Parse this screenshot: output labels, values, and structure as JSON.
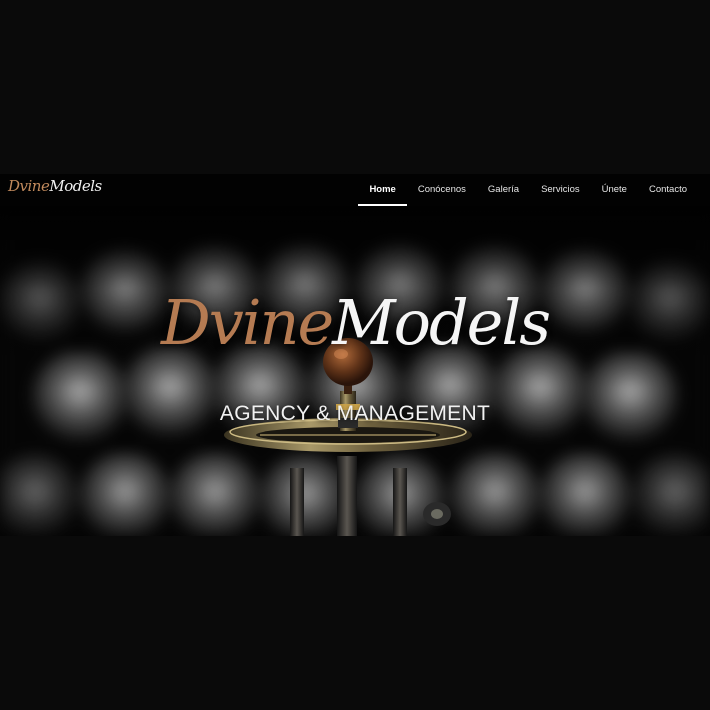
{
  "nav": {
    "logo": {
      "part1": "Dvine",
      "part2": "Models"
    },
    "items": [
      {
        "label": "Home",
        "active": true
      },
      {
        "label": "Conócenos",
        "active": false
      },
      {
        "label": "Galería",
        "active": false
      },
      {
        "label": "Servicios",
        "active": false
      },
      {
        "label": "Únete",
        "active": false
      },
      {
        "label": "Contacto",
        "active": false
      }
    ]
  },
  "hero": {
    "title_part1": "Dvine",
    "title_part2": "Models",
    "subtitle": "AGENCY & MANAGEMENT"
  },
  "colors": {
    "accent_copper": "#b57b52",
    "brass": "#8a7a52",
    "background": "#0a0a0a"
  }
}
